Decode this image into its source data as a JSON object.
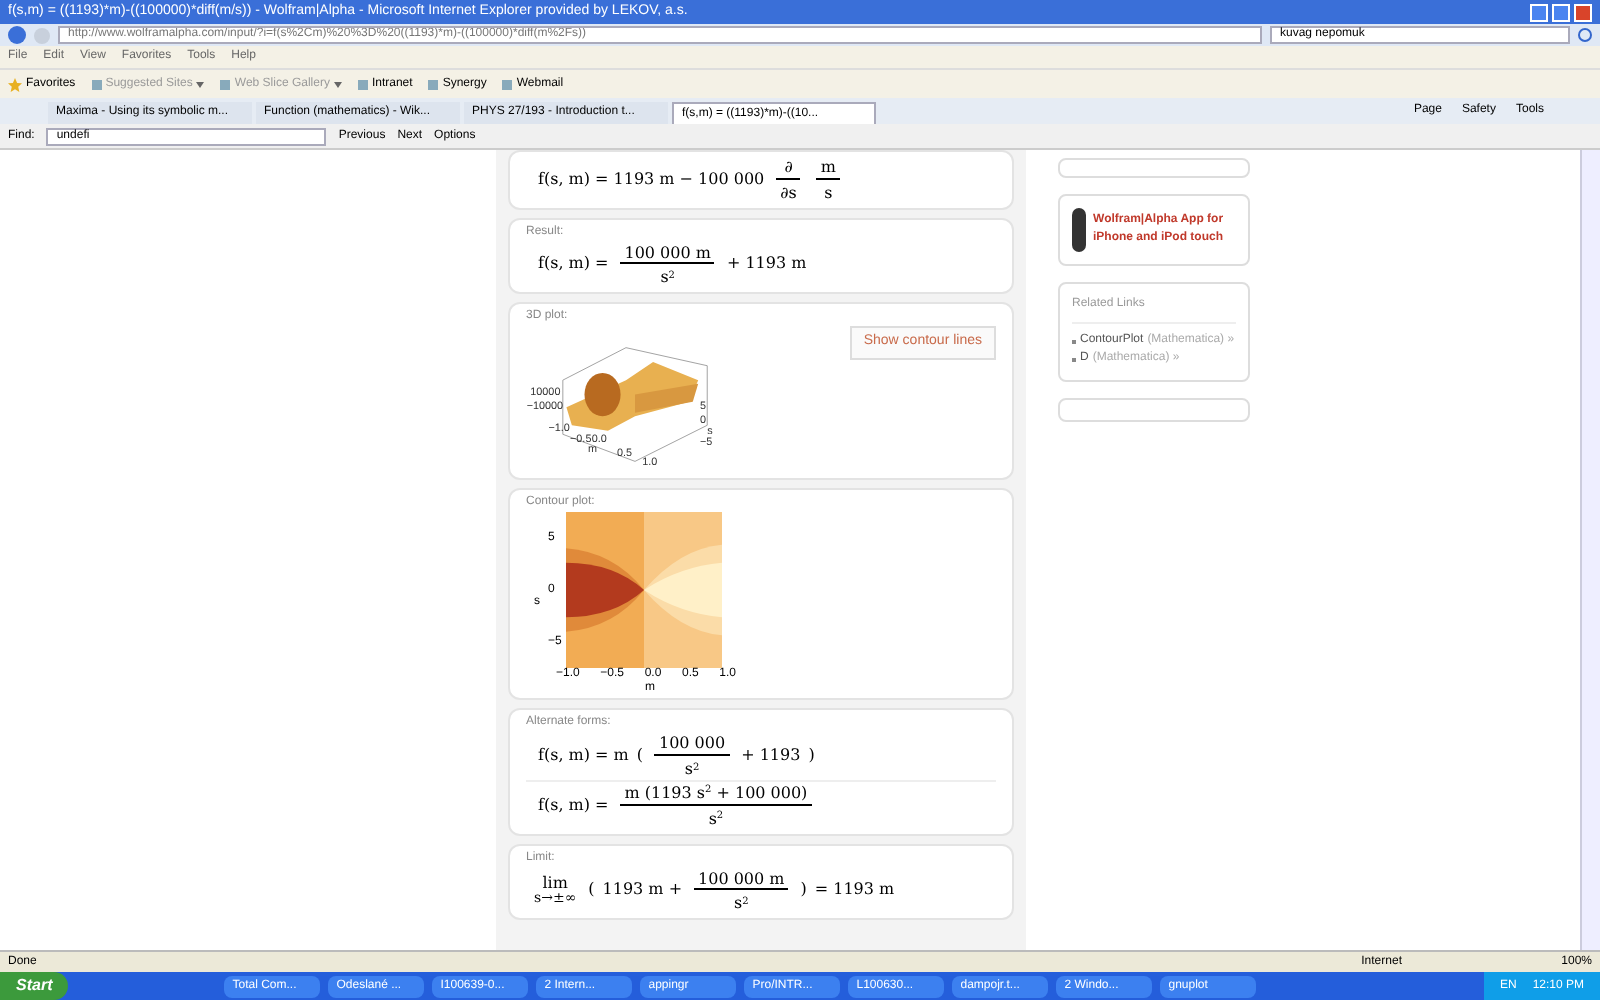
{
  "window": {
    "title": "f(s,m) = ((1193)*m)-((100000)*diff(m/s)) - Wolfram|Alpha - Microsoft Internet Explorer provided by LEKOV, a.s."
  },
  "address_bar": {
    "url": "http://www.wolframalpha.com/input/?i=f(s%2Cm)%20%3D%20((1193)*m)-((100000)*diff(m%2Fs))",
    "search": "kuvag nepomuk"
  },
  "menu": [
    "File",
    "Edit",
    "View",
    "Favorites",
    "Tools",
    "Help"
  ],
  "favorites_bar": [
    {
      "label": "Favorites",
      "kind": "star"
    },
    {
      "label": "Suggested Sites",
      "kind": "dropdown"
    },
    {
      "label": "Web Slice Gallery",
      "kind": "dropdown"
    },
    {
      "label": "Intranet",
      "kind": "link"
    },
    {
      "label": "Synergy",
      "kind": "link"
    },
    {
      "label": "Webmail",
      "kind": "link"
    }
  ],
  "tabs": [
    {
      "label": "Maxima - Using its symbolic m...",
      "selected": false
    },
    {
      "label": "Function (mathematics) - Wik...",
      "selected": false
    },
    {
      "label": "PHYS 27/193 - Introduction t...",
      "selected": false
    },
    {
      "label": "f(s,m) = ((1193)*m)-((10...",
      "selected": true
    }
  ],
  "command_bar": [
    "Page",
    "Safety",
    "Tools"
  ],
  "find_bar": {
    "label": "Find:",
    "value": "undefi",
    "buttons": [
      "Previous",
      "Next",
      "Options"
    ]
  },
  "pods": [
    {
      "kind": "formula",
      "formulas": [
        [
          {
            "kind": "text",
            "text": "f(s, m) = 1193 m − 100 000"
          },
          {
            "kind": "frac",
            "num": "∂",
            "den": "∂s"
          },
          {
            "kind": "frac",
            "num": "m",
            "den": "s"
          }
        ]
      ]
    },
    {
      "kind": "formula",
      "title": "Result:",
      "formulas": [
        [
          {
            "kind": "text",
            "text": "f(s, m) ="
          },
          {
            "kind": "frac",
            "num": "100 000 m",
            "den": "s$^{2}$"
          },
          {
            "kind": "text",
            "text": "+ 1193 m"
          }
        ]
      ]
    },
    {
      "kind": "plot3d",
      "title": "3D plot:",
      "button": "Show contour lines",
      "labels": [
        "10000",
        "−10000",
        "−1.0",
        "−0.5",
        "m",
        "0.0",
        "0.5",
        "1.0",
        "5",
        "0",
        "s",
        "−5"
      ]
    },
    {
      "kind": "contour",
      "title": "Contour plot:",
      "xticks": [
        "−1.0",
        "−0.5",
        "0.0",
        "0.5",
        "1.0"
      ],
      "yticks": [
        "5",
        "0",
        "−5"
      ],
      "xlabel": "m",
      "ylabel": "s"
    },
    {
      "kind": "formula",
      "title": "Alternate forms:",
      "formulas": [
        [
          {
            "kind": "text",
            "text": "f(s, m) = m"
          },
          {
            "kind": "text",
            "text": "("
          },
          {
            "kind": "frac",
            "num": "100 000",
            "den": "s$^{2}$"
          },
          {
            "kind": "text",
            "text": "+ 1193"
          },
          {
            "kind": "text",
            "text": ")"
          }
        ],
        [
          {
            "kind": "text",
            "text": "f(s, m) ="
          },
          {
            "kind": "frac",
            "num": "m (1193 s$^{2}$ + 100 000)",
            "den": "s$^{2}$"
          }
        ]
      ]
    },
    {
      "kind": "formula",
      "title": "Limit:",
      "formulas": [
        [
          {
            "kind": "lim",
            "text": "lim",
            "sub": "s→±∞"
          },
          {
            "kind": "text",
            "text": "("
          },
          {
            "kind": "text",
            "text": "1193 m +"
          },
          {
            "kind": "frac",
            "num": "100 000 m",
            "den": "s$^{2}$"
          },
          {
            "kind": "text",
            "text": ")"
          },
          {
            "kind": "text",
            "text": "= 1193 m"
          }
        ]
      ]
    }
  ],
  "sidebar": {
    "app_promo": "Wolfram|Alpha App for iPhone and iPod touch",
    "related_title": "Related Links",
    "related_links": [
      {
        "name": "ContourPlot",
        "source": "(Mathematica) »"
      },
      {
        "name": "D",
        "source": "(Mathematica) »"
      }
    ]
  },
  "status_bar": {
    "text": "Done",
    "zone": "Internet",
    "zoom": "100%"
  },
  "taskbar": {
    "start": "Start",
    "tasks": [
      "Total Com...",
      "Odeslané ...",
      "I100639-0...",
      "2 Intern...",
      "appingr",
      "Pro/INTR...",
      "L100630...",
      "dampojr.t...",
      "2 Windo...",
      "gnuplot"
    ],
    "language": "EN",
    "clock": "12:10 PM"
  }
}
